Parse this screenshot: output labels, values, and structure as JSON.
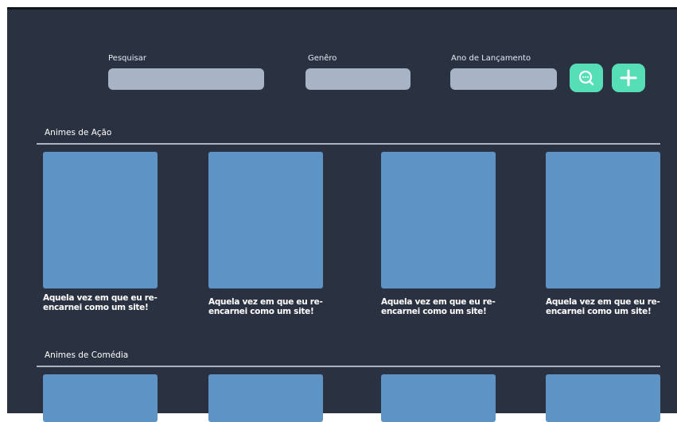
{
  "filters": {
    "search_label": "Pesquisar",
    "genre_label": "Genêro",
    "year_label": "Ano de Lançamento"
  },
  "buttons": {
    "search_icon": "search-icon",
    "add_icon": "plus-icon",
    "accent": "#56dfb6"
  },
  "sections": [
    {
      "title": "Animes de Ação",
      "cards": [
        {
          "title": "Aquela vez em que eu re-\nencarnei como um site!"
        },
        {
          "title": "Aquela vez em que eu re-\nencarnei como um site!"
        },
        {
          "title": "Aquela vez em que eu re-\nencarnei como um site!"
        },
        {
          "title": "Aquela vez em que eu re-\nencarnei como um site!"
        }
      ]
    },
    {
      "title": "Animes de Comédia"
    }
  ]
}
